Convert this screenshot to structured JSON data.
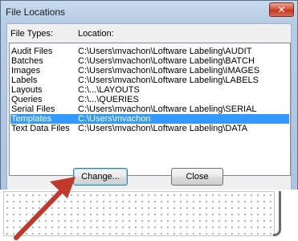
{
  "window": {
    "title": "File Locations",
    "close_label": "✕"
  },
  "columns": {
    "types_label": "File Types:",
    "location_label": "Location:"
  },
  "rows": [
    {
      "type": "Audit Files",
      "location": "C:\\Users\\mvachon\\Loftware Labeling\\AUDIT"
    },
    {
      "type": "Batches",
      "location": "C:\\Users\\mvachon\\Loftware Labeling\\BATCH"
    },
    {
      "type": "Images",
      "location": "C:\\Users\\mvachon\\Loftware Labeling\\IMAGES"
    },
    {
      "type": "Labels",
      "location": "C:\\Users\\mvachon\\Loftware Labeling\\LABELS"
    },
    {
      "type": "Layouts",
      "location": "C:\\...\\LAYOUTS"
    },
    {
      "type": "Queries",
      "location": "C:\\...\\QUERIES"
    },
    {
      "type": "Serial Files",
      "location": "C:\\Users\\mvachon\\Loftware Labeling\\SERIAL"
    },
    {
      "type": "Templates",
      "location": "C:\\Users\\mvachon",
      "selected": true
    },
    {
      "type": "Text Data Files",
      "location": "C:\\Users\\mvachon\\Loftware Labeling\\DATA"
    }
  ],
  "buttons": {
    "change_label": "Change...",
    "close_label": "Close"
  },
  "colors": {
    "selection": "#3399ff",
    "annotation_arrow": "#c0392b"
  }
}
